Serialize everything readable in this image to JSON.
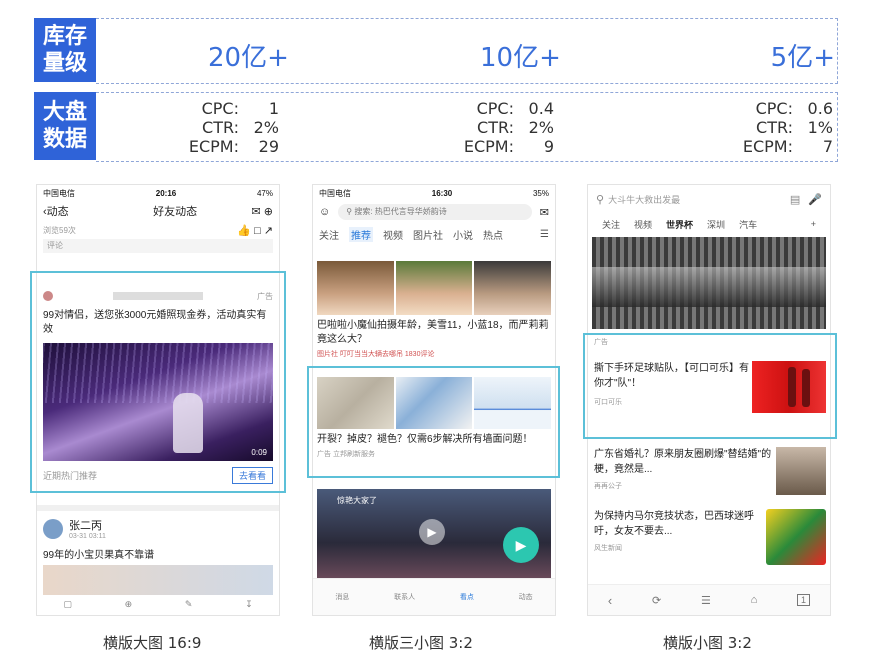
{
  "rows": {
    "inventory": {
      "label_line1": "库存",
      "label_line2": "量级",
      "values": [
        "20亿+",
        "10亿+",
        "5亿+"
      ]
    },
    "market": {
      "label_line1": "大盘",
      "label_line2": "数据",
      "cols": [
        {
          "cpc_k": "CPC:",
          "cpc_v": "1",
          "ctr_k": "CTR:",
          "ctr_v": "2%",
          "ecpm_k": "ECPM:",
          "ecpm_v": "29"
        },
        {
          "cpc_k": "CPC:",
          "cpc_v": "0.4",
          "ctr_k": "CTR:",
          "ctr_v": "2%",
          "ecpm_k": "ECPM:",
          "ecpm_v": "9"
        },
        {
          "cpc_k": "CPC:",
          "cpc_v": "0.6",
          "ctr_k": "CTR:",
          "ctr_v": "1%",
          "ecpm_k": "ECPM:",
          "ecpm_v": "7"
        }
      ]
    }
  },
  "captions": [
    "横版大图 16:9",
    "横版三小图 3:2",
    "横版小图 3:2"
  ],
  "phone1": {
    "carrier": "中国电信",
    "time": "20:16",
    "battery": "47%",
    "back": "动态",
    "title": "好友动态",
    "sub": "浏览59次",
    "comment": "评论",
    "ad_tag": "广告",
    "ad_text": "99对情侣，送您张3000元婚照现金券，活动真实有效",
    "duration": "0:09",
    "footer_left": "近期热门推荐",
    "footer_btn": "去看看",
    "user": "张二丙",
    "date": "03-31 03:11",
    "post": "99年的小宝贝果真不靠谱"
  },
  "phone2": {
    "carrier": "中国电信",
    "time": "16:30",
    "battery": "35%",
    "search": "搜索: 热巴代言导华娇韵诗",
    "tabs": [
      "关注",
      "推荐",
      "视频",
      "图片社",
      "小说",
      "热点"
    ],
    "news_title": "巴啦啦小魔仙拍摄年龄，美雪11，小蓝18，而严莉莉竟这么大？",
    "news_meta": "图片社  叮叮当当大辆去哪吊  1830评论",
    "ad_title": "开裂？掉皮？褪色？仅需6步解决所有墙面问题！",
    "ad_meta": "广告  立邦刷新服务",
    "video_caption": "惊艳大家了",
    "nav": [
      "消息",
      "联系人",
      "看点",
      "动态"
    ]
  },
  "phone3": {
    "search": "大斗牛大救出发最",
    "tabs": [
      "关注",
      "视频",
      "世界杯",
      "深圳",
      "汽车"
    ],
    "ad_tag": "广告",
    "ad_title": "撕下手环足球贴队，【可口可乐】有你才\"队\"！",
    "ad_brand": "可口可乐",
    "n1_title": "广东省婚礼？原来朋友圈刷爆\"替结婚\"的梗，竟然是...",
    "n1_meta": "再再公子",
    "n2_title": "为保持内马尔竞技状态，巴西球迷呼吁，女友不要去...",
    "n2_meta": "风生新闻"
  },
  "colors": {
    "accent": "#2f63d8",
    "highlight": "#5cc0d8"
  }
}
